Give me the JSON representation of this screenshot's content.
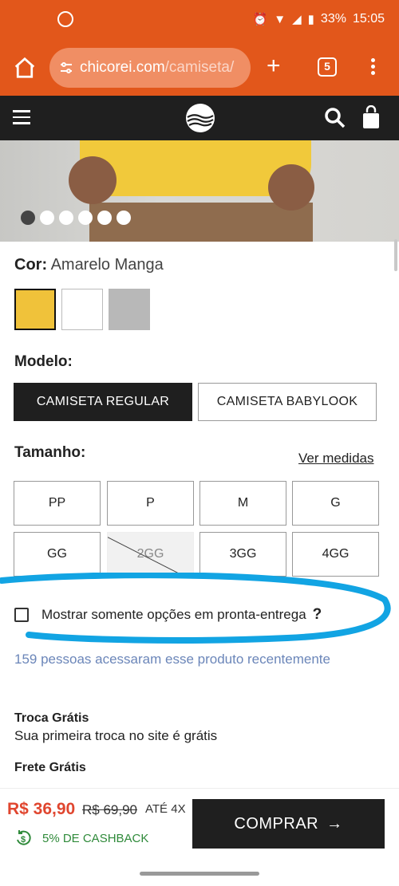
{
  "status_bar": {
    "battery": "33%",
    "time": "15:05"
  },
  "browser": {
    "url_domain": "chicorei.com",
    "url_path": "/camiseta/",
    "tab_count": "5"
  },
  "product": {
    "color_label": "Cor:",
    "color_value": "Amarelo Manga",
    "swatches": [
      "#f0c23a",
      "#ffffff",
      "#b8b8b8"
    ],
    "model_label": "Modelo:",
    "models": [
      "CAMISETA REGULAR",
      "CAMISETA BABYLOOK"
    ],
    "size_label": "Tamanho:",
    "size_guide": "Ver medidas",
    "sizes": [
      "PP",
      "P",
      "M",
      "G",
      "GG",
      "2GG",
      "3GG",
      "4GG"
    ],
    "ready_delivery": "Mostrar somente opções em pronta-entrega",
    "help_mark": "?",
    "visitors": "159 pessoas acessaram esse produto recentemente"
  },
  "benefits": {
    "exchange_title": "Troca Grátis",
    "exchange_text": "Sua primeira troca no site é grátis",
    "shipping_title": "Frete Grátis"
  },
  "purchase": {
    "price": "R$ 36,90",
    "old_price": "R$ 69,90",
    "installments": "ATÉ 4X",
    "cashback": "5% DE CASHBACK",
    "buy_label": "COMPRAR"
  },
  "colors": {
    "brand_orange": "#e2571b",
    "dark": "#1f1f1f",
    "sale_red": "#e0462f",
    "cashback_green": "#2f8a3a",
    "highlight_blue": "#12a4e3"
  }
}
